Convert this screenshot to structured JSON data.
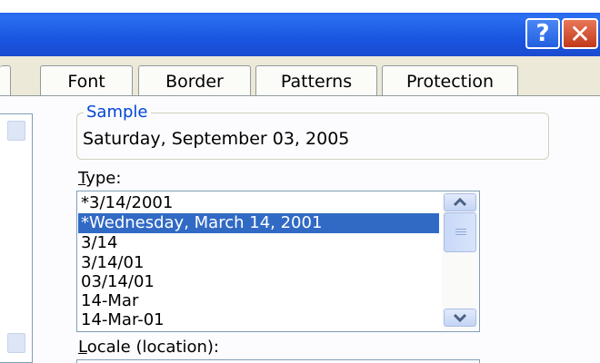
{
  "window": {
    "help_button": "?",
    "close_button": "✕"
  },
  "tabs": {
    "font": "Font",
    "border": "Border",
    "patterns": "Patterns",
    "protection": "Protection"
  },
  "sample": {
    "legend": "Sample",
    "value": "Saturday, September 03, 2005"
  },
  "type": {
    "label_accel": "T",
    "label_rest": "ype:",
    "items": [
      "*3/14/2001",
      "*Wednesday, March 14, 2001",
      "3/14",
      "3/14/01",
      "03/14/01",
      "14-Mar",
      "14-Mar-01"
    ],
    "selected_index": 1
  },
  "locale": {
    "label_accel": "L",
    "label_rest": "ocale (location):"
  },
  "colors": {
    "selection": "#316ac5",
    "legend": "#0046d5",
    "titlebar": "#2b6ff0"
  },
  "icons": {
    "help": "help-icon",
    "close": "close-icon",
    "scroll_up": "chevron-up-icon",
    "scroll_down": "chevron-down-icon"
  }
}
